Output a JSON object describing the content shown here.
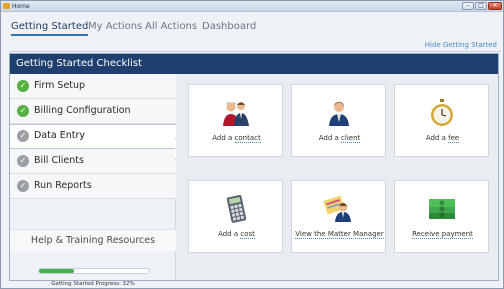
{
  "window": {
    "title": "Home"
  },
  "tabs": [
    {
      "label": "Getting Started",
      "active": true
    },
    {
      "label": "My Actions",
      "active": false
    },
    {
      "label": "All Actions",
      "active": false
    },
    {
      "label": "Dashboard",
      "active": false
    }
  ],
  "hide_link": "Hide Getting Started",
  "checklist": {
    "title": "Getting Started Checklist",
    "steps": [
      {
        "label": "Firm Setup",
        "status": "done"
      },
      {
        "label": "Billing Configuration",
        "status": "done"
      },
      {
        "label": "Data Entry",
        "status": "active"
      },
      {
        "label": "Bill Clients",
        "status": "todo"
      },
      {
        "label": "Run Reports",
        "status": "todo"
      }
    ],
    "help_link": "Help & Training Resources",
    "progress": {
      "percent": 32,
      "label": "Getting Started Progress: 32%"
    }
  },
  "actions": [
    {
      "prefix": "Add a ",
      "link": "contact",
      "icon": "people-contact-icon"
    },
    {
      "prefix": "Add a ",
      "link": "client",
      "icon": "person-client-icon"
    },
    {
      "prefix": "Add a ",
      "link": "fee",
      "icon": "stopwatch-icon"
    },
    {
      "prefix": "Add a ",
      "link": "cost",
      "icon": "calculator-icon"
    },
    {
      "prefix": "",
      "link": "View the Matter Manager",
      "icon": "matter-manager-icon"
    },
    {
      "prefix": "",
      "link": "Receive payment",
      "icon": "money-stack-icon"
    }
  ],
  "colors": {
    "header": "#1f3f6e",
    "done": "#57b043",
    "todo": "#9aa0a6",
    "progress": "#3fb34a",
    "link": "#4a87c7"
  }
}
